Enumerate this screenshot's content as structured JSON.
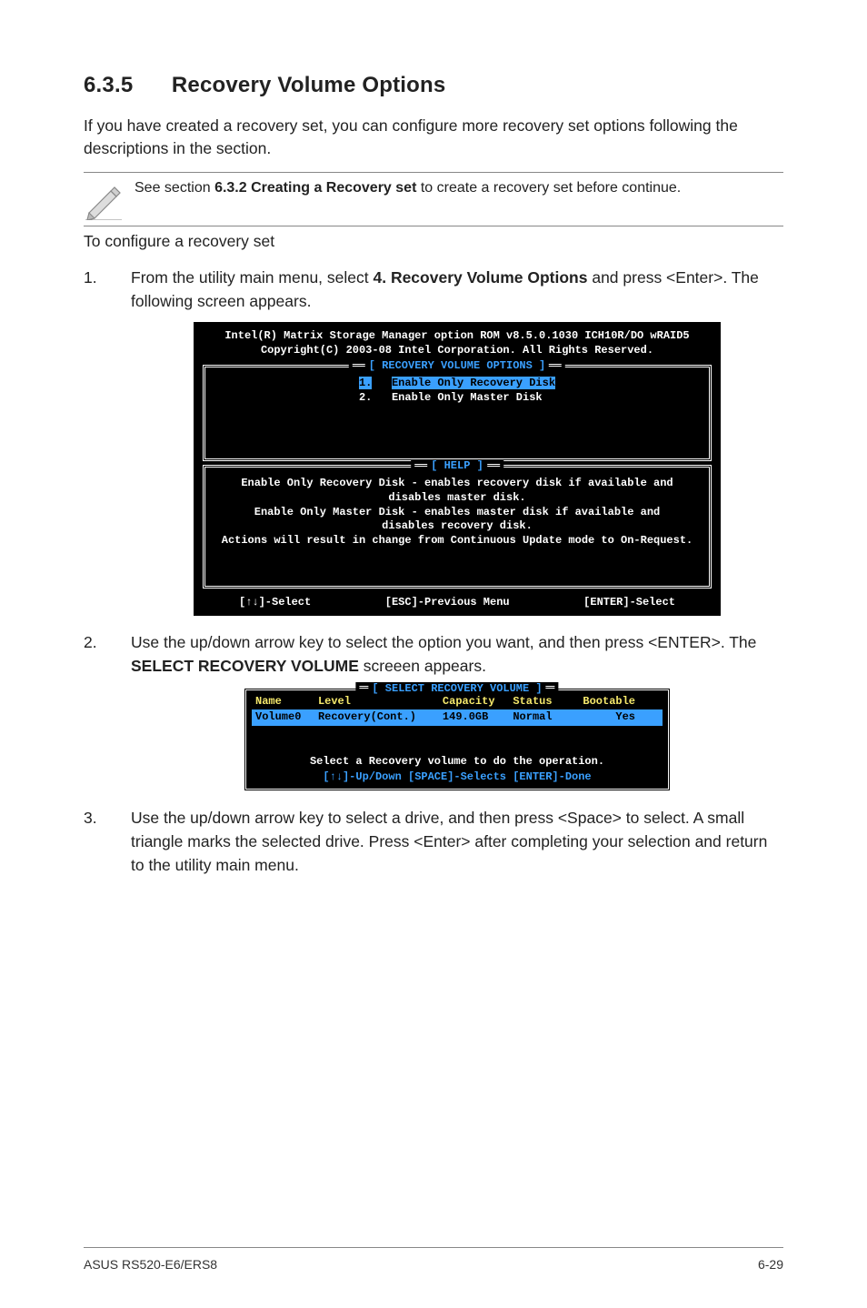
{
  "heading": {
    "num": "6.3.5",
    "title": "Recovery Volume Options"
  },
  "intro": "If you have created a recovery set, you can configure more recovery set options following the descriptions in the section.",
  "note": {
    "pre": "See section ",
    "ref": "6.3.2 Creating a Recovery set",
    "post": " to create a recovery set before continue."
  },
  "sub_line": "To configure a recovery set",
  "steps": {
    "s1": {
      "pre": "From the utility main menu, select ",
      "ref": "4. Recovery Volume Options",
      "post": " and press <Enter>. The following screen appears."
    },
    "s2": {
      "pre": "Use the up/down arrow key to select the option you want, and then press <ENTER>. The ",
      "ref": "SELECT RECOVERY VOLUME",
      "post": " screeen appears."
    },
    "s3": "Use the up/down arrow key to select a drive, and then press <Space> to select. A small triangle marks the selected drive. Press <Enter> after completing your selection and return to the utility main menu."
  },
  "terminal1": {
    "header1": "Intel(R) Matrix Storage Manager option ROM v8.5.0.1030 ICH10R/DO wRAID5",
    "header2": "Copyright(C) 2003-08 Intel Corporation.  All Rights Reserved.",
    "box_options_title": "[ RECOVERY VOLUME OPTIONS ]",
    "opt1_num": "1.",
    "opt1": "Enable Only Recovery Disk",
    "opt2_num": "2.",
    "opt2": "Enable Only Master Disk",
    "box_help_title": "[ HELP ]",
    "help1": "Enable Only Recovery Disk - enables recovery disk if available and",
    "help2": "disables master disk.",
    "help3": "Enable Only Master Disk - enables master disk if available and",
    "help4": "disables recovery disk.",
    "help5": "Actions will result in change from Continuous Update mode to On-Request.",
    "bottom_left": "[↑↓]-Select",
    "bottom_mid": "[ESC]-Previous Menu",
    "bottom_right": "[ENTER]-Select"
  },
  "terminal2": {
    "box_title": "[ SELECT RECOVERY VOLUME ]",
    "th_name": "Name",
    "th_level": "Level",
    "th_cap": "Capacity",
    "th_status": "Status",
    "th_boot": "Bootable",
    "row": {
      "name": "Volume0",
      "level": "Recovery(Cont.)",
      "cap": "149.0GB",
      "status": "Normal",
      "boot": "Yes"
    },
    "msg": "Select a Recovery volume to do the operation.",
    "actions": "[↑↓]-Up/Down [SPACE]-Selects [ENTER]-Done"
  },
  "footer": {
    "left": "ASUS RS520-E6/ERS8",
    "right": "6-29"
  }
}
